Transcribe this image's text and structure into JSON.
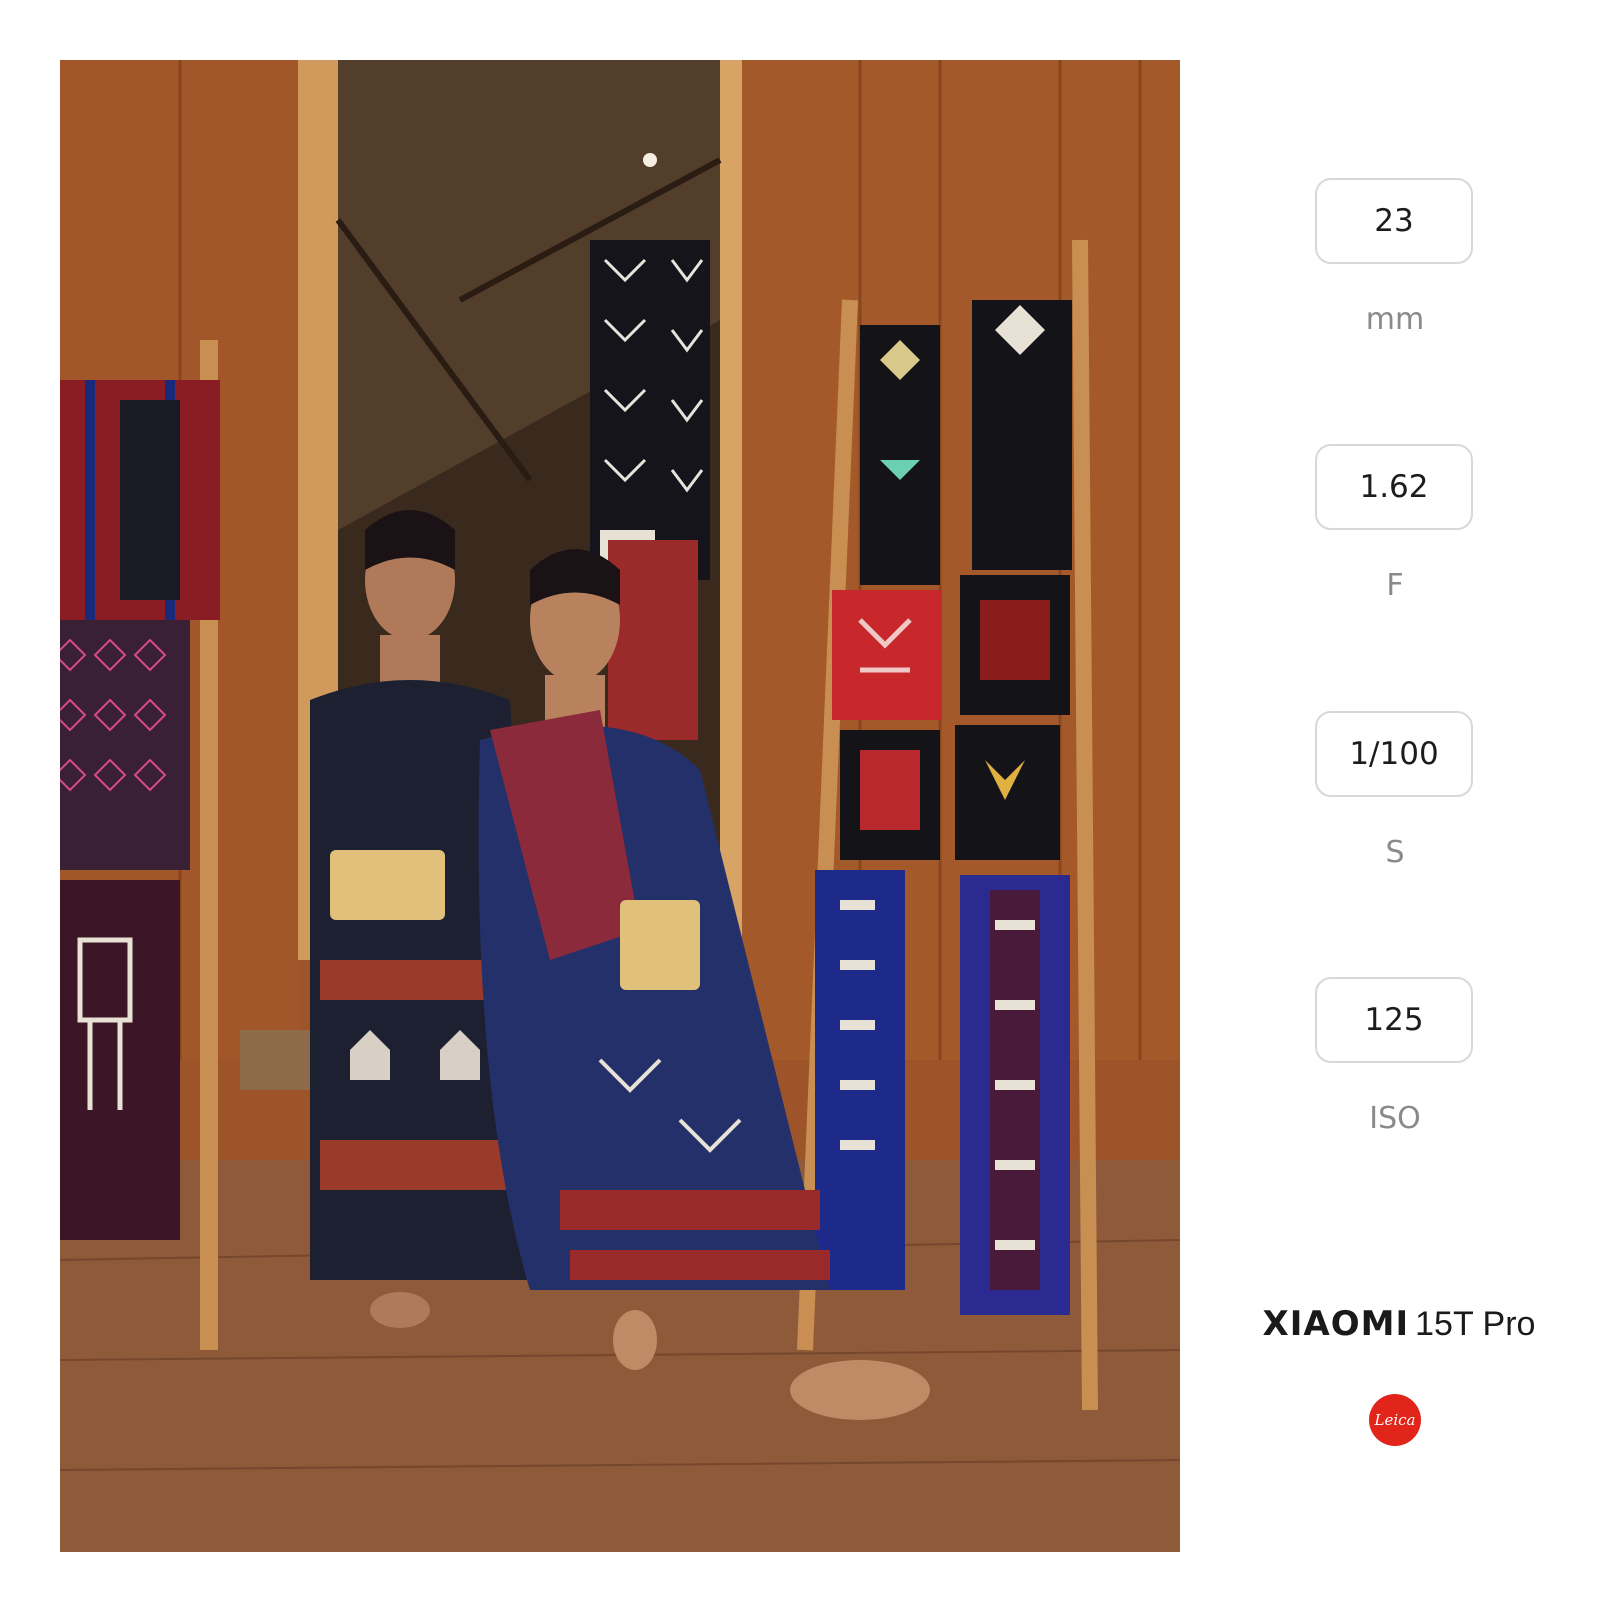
{
  "photo": {
    "description_name": "two-women-in-woven-ikat-textiles-photo"
  },
  "exif": {
    "focal_length": {
      "value": "23",
      "unit": "mm"
    },
    "aperture": {
      "value": "1.62",
      "unit": "F"
    },
    "shutter": {
      "value": "1/100",
      "unit": "S"
    },
    "iso": {
      "value": "125",
      "unit": "ISO"
    }
  },
  "brand": {
    "name": "XIAOMI",
    "model": "15T Pro",
    "badge": "Leica"
  },
  "colors": {
    "wood": "#9c5428",
    "doorway": "#3a2a1e",
    "leica_red": "#e1251b"
  }
}
